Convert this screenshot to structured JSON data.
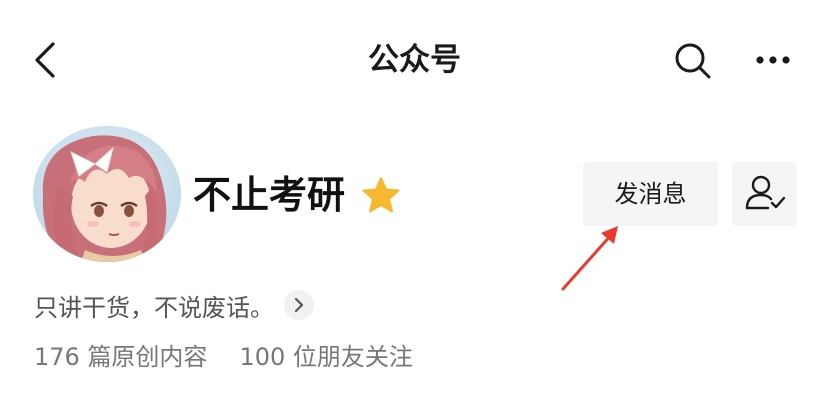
{
  "header": {
    "title": "公众号",
    "back_icon": "chevron-left-icon",
    "search_icon": "search-icon",
    "more_icon": "more-horizontal-icon"
  },
  "profile": {
    "name": "不止考研",
    "verified_icon": "star-icon",
    "verified_color": "#f5b82e",
    "description": "只讲干货，不说废话。",
    "message_button": "发消息",
    "follow_icon": "person-check-icon",
    "stats": {
      "posts": "176 篇原创内容",
      "friends_following": "100 位朋友关注"
    }
  },
  "annotation": {
    "arrow_color": "#e83a2f"
  }
}
